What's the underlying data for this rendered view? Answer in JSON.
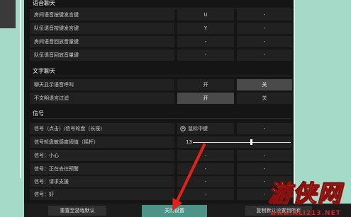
{
  "colors": {
    "background_teal": "#a5dac9",
    "panel": "#151515",
    "row": "#212121",
    "selected_cell": "#4a4a4a",
    "close_button": "#4d9487",
    "arrow": "#e0221b",
    "watermark_logo": "#f3c13a",
    "watermark_url": "#d8251a"
  },
  "voice_chat": {
    "title": "语音聊天",
    "rows": [
      {
        "label": "房间语音按键发言键",
        "value1": "U",
        "value2": "-"
      },
      {
        "label": "队伍语音按键发言键",
        "value1": "Y",
        "value2": "-"
      },
      {
        "label": "房间语音回放音量键",
        "value1": "-",
        "value2": "-"
      },
      {
        "label": "队伍语音回放音量键",
        "value1": "-",
        "value2": "-"
      }
    ]
  },
  "text_chat": {
    "title": "文字聊天",
    "rows": [
      {
        "label": "聊天显示语音呼叫",
        "options": [
          {
            "text": "开",
            "selected": false
          },
          {
            "text": "关",
            "selected": true
          }
        ]
      },
      {
        "label": "不文明语言过滤",
        "options": [
          {
            "text": "开",
            "selected": true
          },
          {
            "text": "关",
            "selected": false
          }
        ]
      }
    ]
  },
  "signals": {
    "title": "信号",
    "rows": [
      {
        "label": "信号（点击）/信号轮盘（长按）",
        "icon": "mouse-icon",
        "value1": "鼠标中键",
        "value2": "-"
      },
      {
        "label": "信号轮盘敏感度阈值（摇杆）",
        "value": "13",
        "slider_level": 0.6
      },
      {
        "label": "信号：小心",
        "value1": "-",
        "value2": "-"
      },
      {
        "label": "信号：正在去往预警",
        "value1": "-",
        "value2": "-"
      },
      {
        "label": "信号：请求支援",
        "value1": "-",
        "value2": "-"
      },
      {
        "label": "信号：好",
        "value1": "-",
        "value2": "-"
      }
    ]
  },
  "footer": {
    "reset_label": "重置至游戏默认",
    "close_label": "关闭设置",
    "copy_label": "复制默认设置到所有"
  },
  "watermark": {
    "logo": "游侠网",
    "url": "www.ALI213.NET"
  }
}
